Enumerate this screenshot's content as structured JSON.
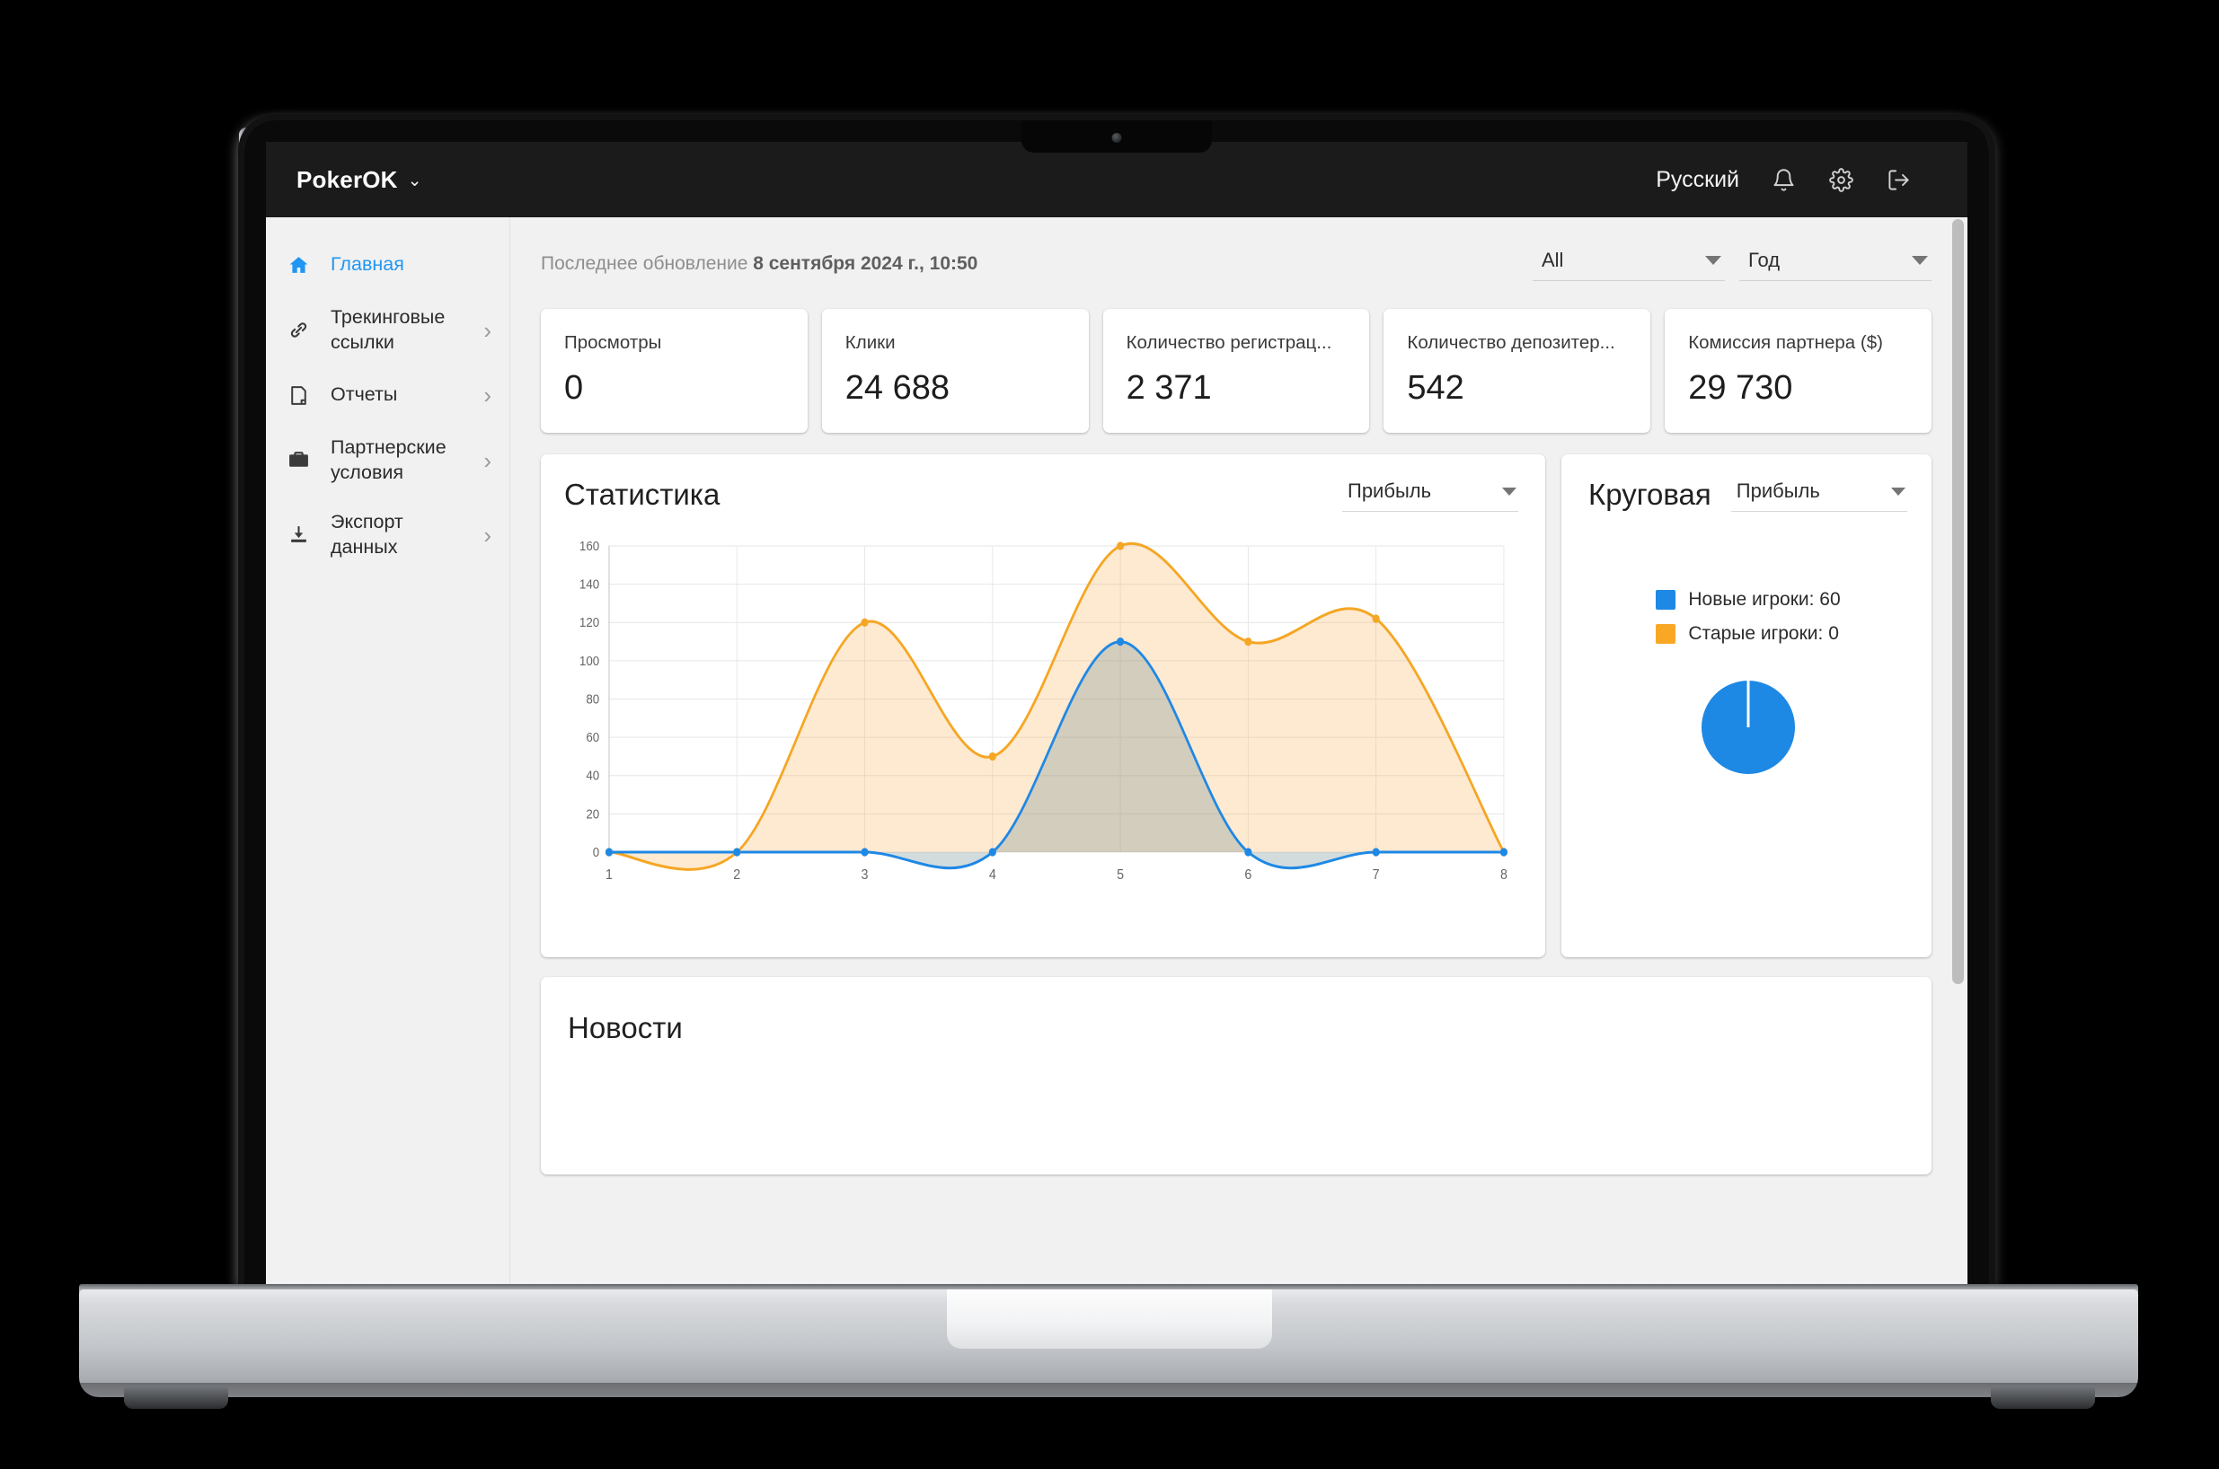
{
  "topbar": {
    "brand": "PokerOK",
    "brand_chevron": "⌄",
    "language": "Русский",
    "icons": [
      "bell-icon",
      "gear-icon",
      "logout-icon"
    ]
  },
  "sidebar": {
    "items": [
      {
        "label": "Главная",
        "icon": "home-icon",
        "active": true,
        "arrow": ""
      },
      {
        "label": "Трекинговые ссылки",
        "icon": "link-icon",
        "active": false,
        "arrow": "›"
      },
      {
        "label": "Отчеты",
        "icon": "document-icon",
        "active": false,
        "arrow": "›"
      },
      {
        "label": "Партнерские условия",
        "icon": "briefcase-icon",
        "active": false,
        "arrow": "›"
      },
      {
        "label": "Экспорт данных",
        "icon": "download-icon",
        "active": false,
        "arrow": "›"
      }
    ]
  },
  "header": {
    "updated_prefix": "Последнее обновление",
    "updated_value": "8 сентября 2024 г., 10:50",
    "filter_scope": "All",
    "filter_period": "Год"
  },
  "cards": [
    {
      "label": "Просмотры",
      "value": "0"
    },
    {
      "label": "Клики",
      "value": "24 688"
    },
    {
      "label": "Количество регистрац...",
      "value": "2 371"
    },
    {
      "label": "Количество депозитер...",
      "value": "542"
    },
    {
      "label": "Комиссия партнера ($)",
      "value": "29 730"
    }
  ],
  "stats_panel": {
    "title": "Статистика",
    "metric": "Прибыль"
  },
  "pie_panel": {
    "title": "Круговая",
    "metric": "Прибыль",
    "legend": [
      {
        "label": "Новые игроки: 60",
        "color": "#1e88e5"
      },
      {
        "label": "Старые игроки: 0",
        "color": "#f9a825"
      }
    ]
  },
  "news": {
    "title": "Новости"
  },
  "colors": {
    "blue": "#2196f3",
    "blue_line": "#1e88e5",
    "orange": "#f5a623",
    "blue_fill": "rgba(120,150,150,0.33)",
    "orange_fill": "rgba(250,175,90,0.28)",
    "topbar_bg": "#1b1b1b",
    "page_bg": "#f1f1f1"
  },
  "chart_data": [
    {
      "type": "area",
      "title": "Статистика",
      "xlabel": "",
      "ylabel": "",
      "x": [
        1,
        2,
        3,
        4,
        5,
        6,
        7,
        8
      ],
      "xticks": [
        "1",
        "2",
        "3",
        "4",
        "5",
        "6",
        "7",
        "8"
      ],
      "yticks": [
        0,
        20,
        40,
        60,
        80,
        100,
        120,
        140,
        160
      ],
      "ylim": [
        0,
        160
      ],
      "grid": true,
      "legend_position": "none",
      "series": [
        {
          "name": "Старые игроки",
          "color": "#f5a623",
          "values": [
            0,
            0,
            120,
            50,
            160,
            110,
            122,
            0
          ]
        },
        {
          "name": "Новые игроки",
          "color": "#1e88e5",
          "values": [
            0,
            0,
            0,
            0,
            110,
            0,
            0,
            0
          ]
        }
      ]
    },
    {
      "type": "pie",
      "title": "Круговая",
      "labels": [
        "Новые игроки",
        "Старые игроки"
      ],
      "values": [
        60,
        0
      ],
      "colors": [
        "#1e88e5",
        "#f9a825"
      ],
      "legend_position": "top"
    }
  ]
}
